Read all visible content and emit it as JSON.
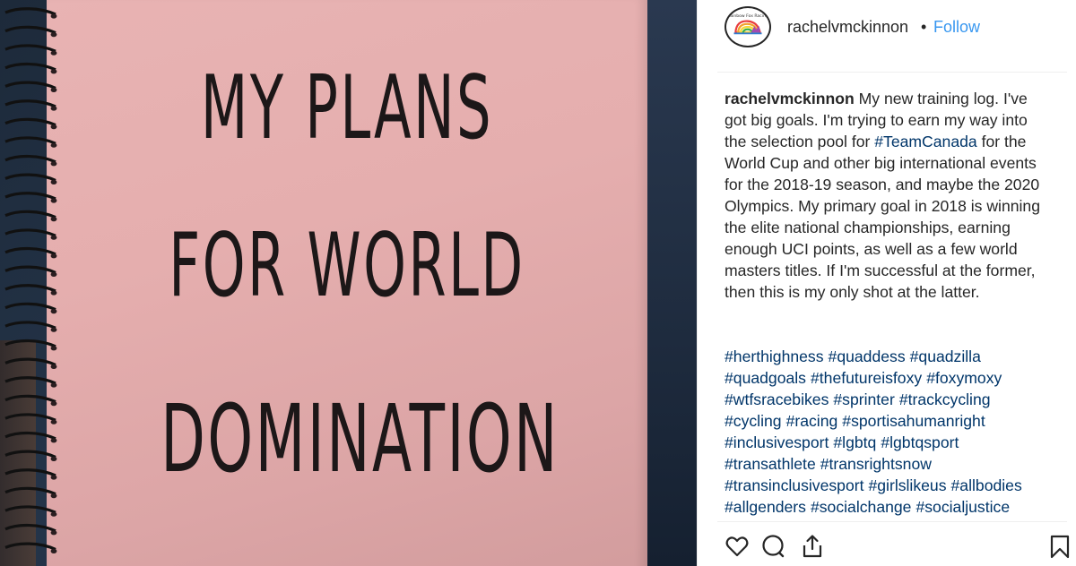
{
  "photo": {
    "alt_icon": "notebook-photo",
    "cover_lines": [
      "MY PLANS",
      "FOR WORLD",
      "DOMINATION"
    ]
  },
  "header": {
    "username": "rachelvmckinnon",
    "separator": "•",
    "follow_label": "Follow",
    "avatar_icon": "rainbow-fox-racing-logo",
    "avatar_text": "Rainbow Fox Racing"
  },
  "caption": {
    "author": "rachelvmckinnon",
    "text_1": "My new training log. I've got big goals. I'm trying to earn my way into the selection pool for ",
    "tag_inline": "#TeamCanada",
    "text_2": " for the World Cup and other big international events for the 2018-19 season, and maybe the 2020 Olympics. My primary goal in 2018 is winning the elite national championships, earning enough UCI points, as well as a few world masters titles. If I'm successful at the former, then this is my only shot at the latter."
  },
  "hashtags": [
    [
      "#herthighness",
      "#quaddess",
      "#quadzilla"
    ],
    [
      "#quadgoals",
      "#thefutureisfoxy",
      "#foxymoxy"
    ],
    [
      "#wtfsracebikes",
      "#sprinter",
      "#trackcycling"
    ],
    [
      "#cycling",
      "#racing",
      "#sportisahumanright"
    ],
    [
      "#inclusivesport",
      "#lgbtq",
      "#lgbtqsport"
    ],
    [
      "#transathlete",
      "#transrightsnow"
    ],
    [
      "#transinclusivesport",
      "#girlslikeus",
      "#allbodies"
    ],
    [
      "#allgenders",
      "#socialchange",
      "#socialjustice"
    ]
  ],
  "actions": {
    "like_icon": "heart-icon",
    "comment_icon": "comment-icon",
    "share_icon": "share-icon",
    "save_icon": "bookmark-icon"
  },
  "colors": {
    "link": "#003569",
    "follow": "#3897f0",
    "cover_pink": "#e5aeae",
    "text": "#262626"
  }
}
